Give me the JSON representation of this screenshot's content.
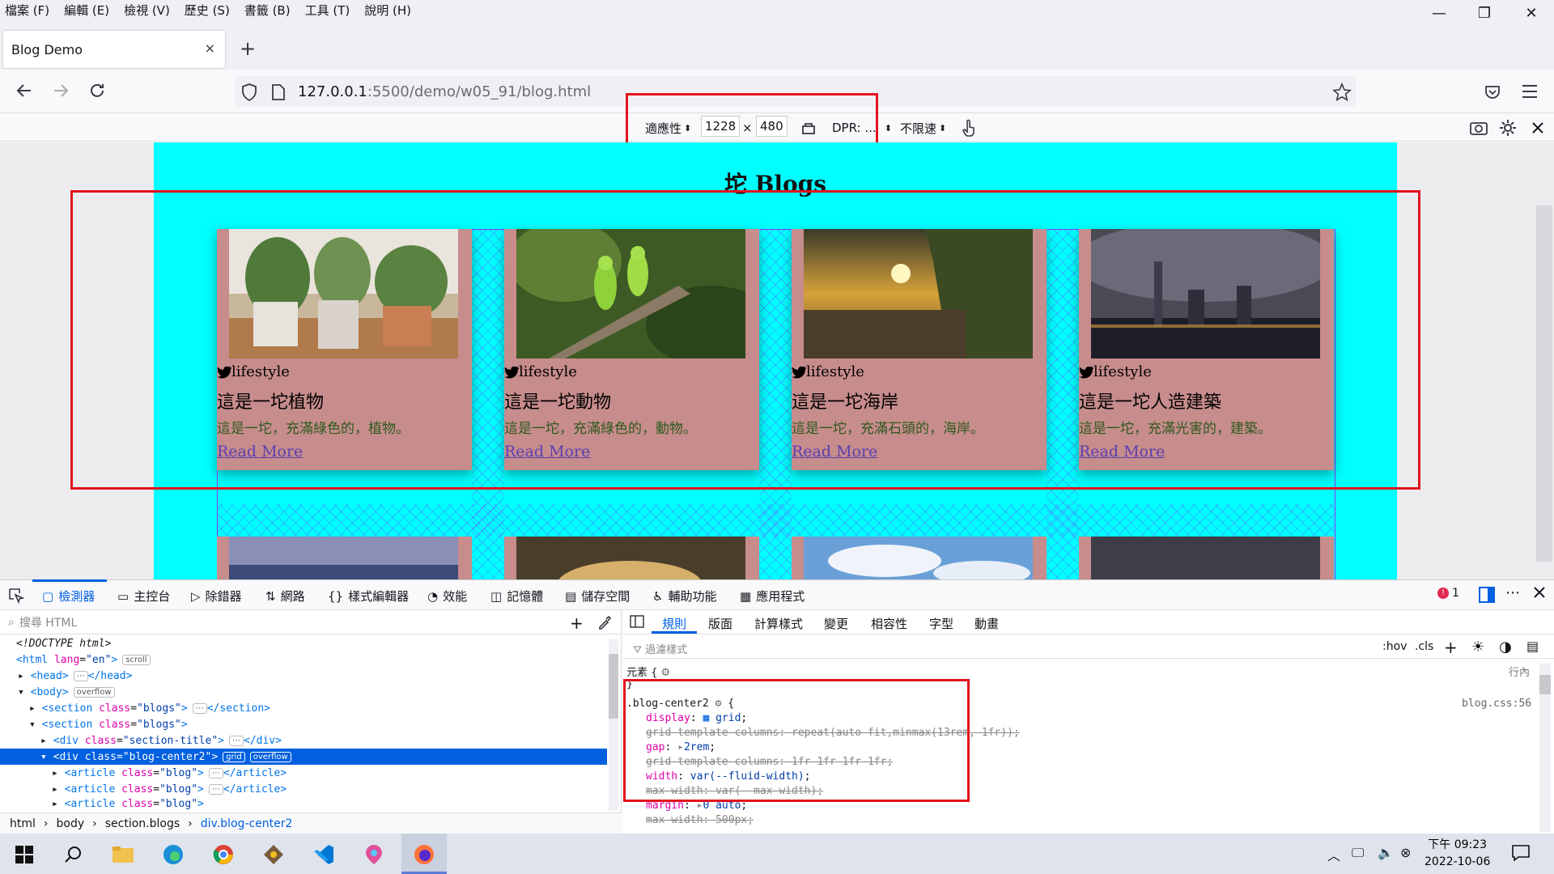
{
  "menubar": {
    "items": [
      "檔案 (F)",
      "編輯 (E)",
      "檢視 (V)",
      "歷史 (S)",
      "書籤 (B)",
      "工具 (T)",
      "說明 (H)"
    ]
  },
  "window": {
    "minimize": "—",
    "restore": "❐",
    "close": "✕"
  },
  "tab": {
    "title": "Blog Demo",
    "close": "×",
    "new": "+"
  },
  "url": {
    "host": "127.0.0.1",
    "path": ":5500/demo/w05_91/blog.html"
  },
  "rdm": {
    "device": "適應性",
    "width": "1228",
    "times": "×",
    "height": "480",
    "dpr": "DPR: ...",
    "throttle": "不限速"
  },
  "page": {
    "title": "坨 Blogs",
    "cards": [
      {
        "tag": "lifestyle",
        "title": "這是一坨植物",
        "desc": "這是一坨，充滿綠色的，植物。",
        "more": "Read More"
      },
      {
        "tag": "lifestyle",
        "title": "這是一坨動物",
        "desc": "這是一坨，充滿綠色的，動物。",
        "more": "Read More"
      },
      {
        "tag": "lifestyle",
        "title": "這是一坨海岸",
        "desc": "這是一坨，充滿石頭的，海岸。",
        "more": "Read More"
      },
      {
        "tag": "lifestyle",
        "title": "這是一坨人造建築",
        "desc": "這是一坨，充滿光害的，建築。",
        "more": "Read More"
      }
    ]
  },
  "devtools": {
    "tabs": [
      "檢測器",
      "主控台",
      "除錯器",
      "網路",
      "樣式編輯器",
      "效能",
      "記憶體",
      "儲存空間",
      "輔助功能",
      "應用程式"
    ],
    "error_count": "1",
    "search_placeholder": "搜尋 HTML",
    "tree": [
      {
        "text": "<!DOCTYPE html>"
      },
      {
        "tag": "html",
        "attr": "lang",
        "val": "\"en\"",
        "badge": "scroll"
      },
      {
        "tag": "head",
        "badge": "⋯",
        "close": "</head>"
      },
      {
        "tag": "body",
        "badge": "overflow"
      },
      {
        "tag": "section",
        "attr": "class",
        "val": "\"blogs\"",
        "close": "</section>"
      },
      {
        "tag": "section",
        "attr": "class",
        "val": "\"blogs\""
      },
      {
        "tag": "div",
        "attr": "class",
        "val": "\"section-title\"",
        "close": "</div>"
      },
      {
        "tag": "div",
        "attr": "class",
        "val": "\"blog-center2\"",
        "badge": "grid",
        "badge2": "overflow"
      },
      {
        "tag": "article",
        "attr": "class",
        "val": "\"blog\"",
        "close": "</article>"
      },
      {
        "tag": "article",
        "attr": "class",
        "val": "\"blog\"",
        "close": "</article>"
      },
      {
        "tag": "article",
        "attr": "class",
        "val": "\"blog\"",
        "close": "</article>"
      }
    ],
    "breadcrumbs": [
      "html",
      "body",
      "section.blogs",
      "div.blog-center2"
    ],
    "rule_tabs": [
      "規則",
      "版面",
      "計算樣式",
      "變更",
      "相容性",
      "字型",
      "動畫"
    ],
    "filter_placeholder": "過濾樣式",
    "hov": ":hov",
    "cls": ".cls",
    "element_rule": "元素 {",
    "inline": "行內",
    "close_brace": "}",
    "selector": ".blog-center2",
    "source": "blog.css:56",
    "decls": [
      {
        "name": "display",
        "value": "grid",
        "struck": false
      },
      {
        "name": "grid-template-columns",
        "value": "repeat(auto-fit,minmax(13rem, 1fr))",
        "struck": true
      },
      {
        "name": "gap",
        "value": "2rem",
        "struck": false
      },
      {
        "name": "grid-template-columns",
        "value": "1fr 1fr 1fr 1fr",
        "struck": true
      },
      {
        "name": "width",
        "value": "var(--fluid-width)",
        "struck": false
      },
      {
        "name": "max-width",
        "value": "var(--max-width)",
        "struck": true
      },
      {
        "name": "margin",
        "value": "0 auto",
        "struck": false
      },
      {
        "name": "max-width",
        "value": "500px",
        "struck": true
      }
    ]
  },
  "taskbar": {
    "time": "下午 09:23",
    "date": "2022-10-06"
  },
  "colors": {
    "page_bg": "#00ffff",
    "card_bg": "#c78c8c",
    "highlight": "#e3141e",
    "accent": "#0060df"
  }
}
